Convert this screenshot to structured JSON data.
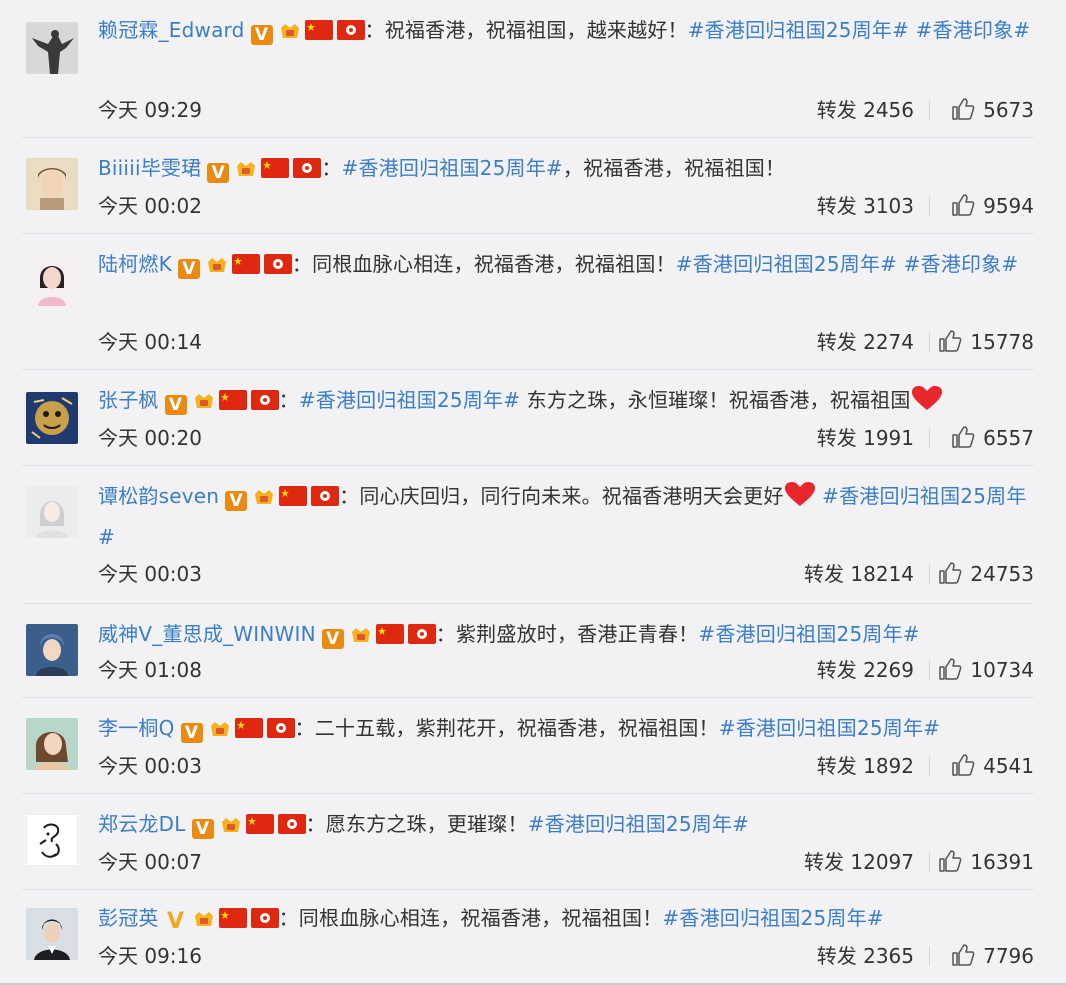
{
  "comments": [
    {
      "user": "赖冠霖_Edward",
      "text": "：祝福香港，祝福祖国，越来越好！",
      "topic": "#香港回归祖国25周年# #香港印象#",
      "after": "",
      "time": "今天 09:29",
      "repost": "转发 2456",
      "likes": "5673"
    },
    {
      "user": "Biiiii毕雯珺",
      "text": "：",
      "topic": "#香港回归祖国25周年#",
      "after": "，祝福香港，祝福祖国！",
      "time": "今天 00:02",
      "repost": "转发 3103",
      "likes": "9594"
    },
    {
      "user": "陆柯燃K",
      "text": "：同根血脉心相连，祝福香港，祝福祖国！",
      "topic": "#香港回归祖国25周年# #香港印象#",
      "after": "",
      "time": "今天 00:14",
      "repost": "转发 2274",
      "likes": "15778"
    },
    {
      "user": "张子枫",
      "text": "：",
      "topic": "#香港回归祖国25周年#",
      "after": " 东方之珠，永恒璀璨！祝福香港，祝福祖国",
      "time": "今天 00:20",
      "repost": "转发 1991",
      "likes": "6557"
    },
    {
      "user": "谭松韵seven",
      "text": "：同心庆回归，同行向未来。祝福香港明天会更好",
      "topic": "#香港回归祖国25周年#",
      "after": "",
      "time": "今天 00:03",
      "repost": "转发 18214",
      "likes": "24753"
    },
    {
      "user": "威神V_董思成_WINWIN",
      "text": "：紫荆盛放时，香港正青春！",
      "topic": "#香港回归祖国25周年#",
      "after": "",
      "time": "今天 01:08",
      "repost": "转发 2269",
      "likes": "10734"
    },
    {
      "user": "李一桐Q",
      "text": "：二十五载，紫荆花开，祝福香港，祝福祖国！",
      "topic": "#香港回归祖国25周年#",
      "after": "",
      "time": "今天 00:03",
      "repost": "转发 1892",
      "likes": "4541"
    },
    {
      "user": "郑云龙DL",
      "text": "：愿东方之珠，更璀璨！",
      "topic": "#香港回归祖国25周年#",
      "after": "",
      "time": "今天 00:07",
      "repost": "转发 12097",
      "likes": "16391"
    },
    {
      "user": "彭冠英",
      "text": "：同根血脉心相连，祝福香港，祝福祖国！",
      "topic": "#香港回归祖国25周年#",
      "after": "",
      "time": "今天 09:16",
      "repost": "转发 2365",
      "likes": "7796"
    }
  ],
  "badges": {
    "verified": "V",
    "icons": [
      "verified-v-icon",
      "crown-fan-badge-icon",
      "china-flag-icon",
      "hong-kong-flag-icon"
    ]
  },
  "icons": {
    "like": "thumbs-up-icon",
    "heart": "red-heart-emoji"
  },
  "colors": {
    "background": "#f2f2f5",
    "username": "#3b7ec4",
    "topic": "#3b7ec4",
    "body_text": "#333333",
    "verified_badge": "#ea8a10",
    "flag_red": "#de2910",
    "divider": "#e2e2e6"
  }
}
